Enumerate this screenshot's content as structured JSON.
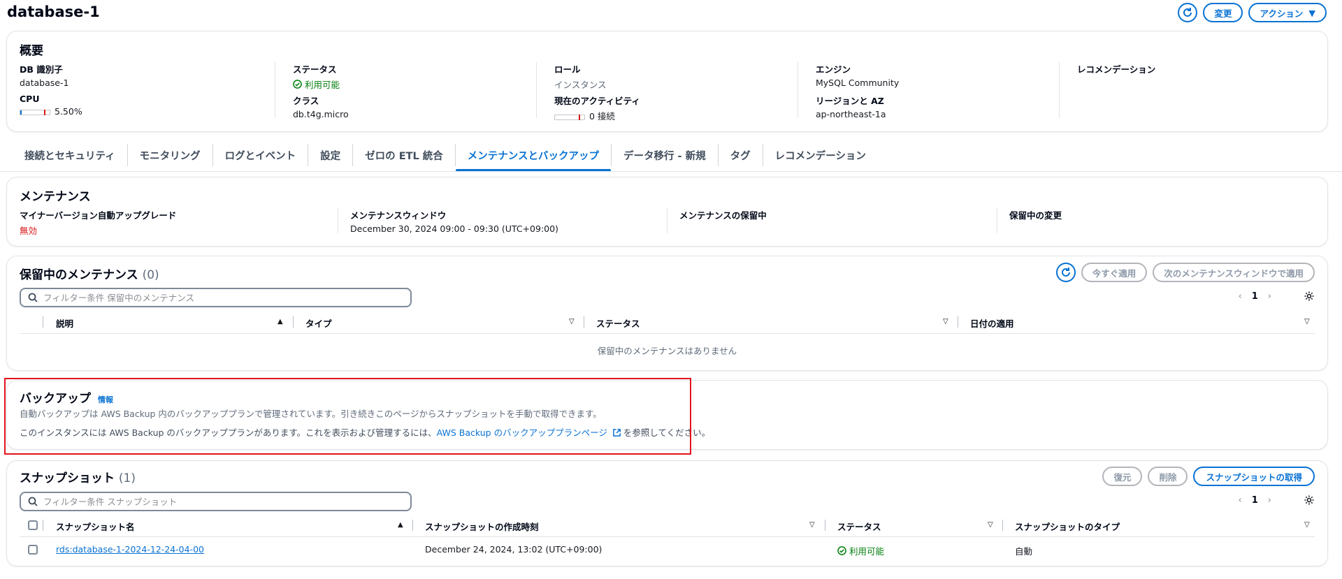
{
  "page": {
    "title": "database-1",
    "header_buttons": {
      "modify": "変更",
      "actions": "アクション"
    }
  },
  "summary": {
    "title": "概要",
    "db_id_label": "DB 識別子",
    "db_id": "database-1",
    "cpu_label": "CPU",
    "cpu_value": "5.50%",
    "cpu_percent": 5.5,
    "status_label": "ステータス",
    "status": "利用可能",
    "class_label": "クラス",
    "class_value": "db.t4g.micro",
    "role_label": "ロール",
    "role": "インスタンス",
    "activity_label": "現在のアクティビティ",
    "activity": "0 接続",
    "engine_label": "エンジン",
    "engine": "MySQL Community",
    "region_label": "リージョンと AZ",
    "region": "ap-northeast-1a",
    "recommend_label": "レコメンデーション"
  },
  "tabs": [
    {
      "label": "接続とセキュリティ"
    },
    {
      "label": "モニタリング"
    },
    {
      "label": "ログとイベント"
    },
    {
      "label": "設定"
    },
    {
      "label": "ゼロの ETL 統合"
    },
    {
      "label": "メンテナンスとバックアップ",
      "active": true
    },
    {
      "label": "データ移行 - 新規"
    },
    {
      "label": "タグ"
    },
    {
      "label": "レコメンデーション"
    }
  ],
  "maintenance": {
    "title": "メンテナンス",
    "auto_upgrade_label": "マイナーバージョン自動アップグレード",
    "auto_upgrade": "無効",
    "window_label": "メンテナンスウィンドウ",
    "window": "December 30, 2024 09:00 - 09:30 (UTC+09:00)",
    "pending_label": "メンテナンスの保留中",
    "pending_changes_label": "保留中の変更"
  },
  "pending": {
    "title": "保留中のメンテナンス",
    "count": "(0)",
    "apply_now": "今すぐ適用",
    "apply_next": "次のメンテナンスウィンドウで適用",
    "search_placeholder": "フィルター条件 保留中のメンテナンス",
    "page": "1",
    "columns": [
      "説明",
      "タイプ",
      "ステータス",
      "日付の適用"
    ],
    "empty": "保留中のメンテナンスはありません"
  },
  "backup": {
    "title": "バックアップ",
    "info": "情報",
    "line1": "自動バックアップは AWS Backup 内のバックアッププランで管理されています。引き続きこのページからスナップショットを手動で取得できます。",
    "line2_prefix": "このインスタンスには AWS Backup のバックアッププランがあります。これを表示および管理するには、",
    "line2_link": "AWS Backup のバックアッププランページ",
    "line2_suffix": "を参照してください。"
  },
  "snapshots": {
    "title": "スナップショット",
    "count": "(1)",
    "restore": "復元",
    "delete": "削除",
    "take": "スナップショットの取得",
    "search_placeholder": "フィルター条件 スナップショット",
    "page": "1",
    "columns": [
      "スナップショット名",
      "スナップショットの作成時刻",
      "ステータス",
      "スナップショットのタイプ"
    ],
    "rows": [
      {
        "name": "rds:database-1-2024-12-24-04-00",
        "created": "December 24, 2024, 13:02 (UTC+09:00)",
        "status": "利用可能",
        "type": "自動"
      }
    ]
  },
  "colors": {
    "accent": "#0972d3",
    "success": "#037f0c",
    "danger": "#d91515",
    "highlight": "#e0141e"
  }
}
